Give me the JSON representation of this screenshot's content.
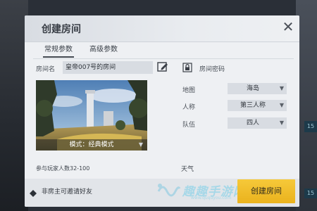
{
  "background": {
    "right_badge_1": "15",
    "right_badge_2": "15"
  },
  "dialog": {
    "title": "创建房间",
    "close_icon": "close-icon",
    "tabs": [
      {
        "label": "常规参数",
        "active": true
      },
      {
        "label": "高级参数",
        "active": false
      }
    ],
    "room_name_label": "房间名",
    "room_name_value": "皇帝007号的房间",
    "edit_icon": "edit-icon",
    "lock_icon": "lock-icon",
    "room_password_label": "房间密码",
    "map_label": "地图",
    "map_value": "海岛",
    "perspective_label": "人称",
    "perspective_value": "第三人称",
    "team_label": "队伍",
    "team_value": "四人",
    "mode_text": "模式：经典模式",
    "players_text": "参与玩家人数32-100",
    "weather_label": "天气",
    "invite_text": "非房主可邀请好友",
    "create_button": "创建房间",
    "watermark_text": "趣趣手游网",
    "watermark_url": "www.ququyou.com"
  },
  "colors": {
    "accent": "#f0bd2a",
    "panel": "#eef0f3",
    "field": "#d8dce2"
  }
}
